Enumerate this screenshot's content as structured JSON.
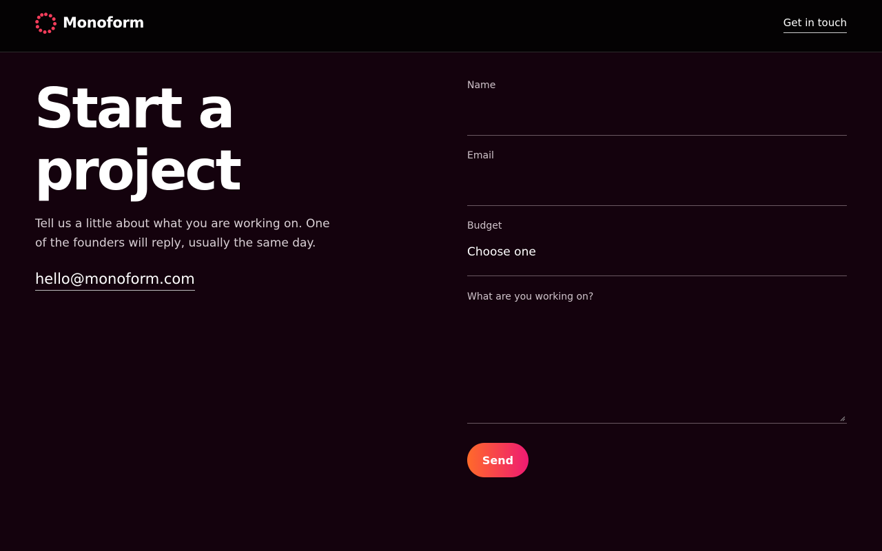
{
  "header": {
    "logo_icon": "ring-of-dots-logo-icon",
    "brand_name": "Monoform",
    "nav_link": "Get in touch"
  },
  "hero": {
    "title_line1": "Start a",
    "title_line2": "project",
    "subtitle": "Tell us a little about what you are working on. One of the founders will reply, usually the same day.",
    "email": "hello@monoform.com"
  },
  "form": {
    "name": {
      "label": "Name",
      "value": ""
    },
    "email": {
      "label": "Email",
      "value": ""
    },
    "budget": {
      "label": "Budget",
      "selected": "Choose one"
    },
    "message": {
      "label": "What are you working on?",
      "value": ""
    },
    "send_label": "Send"
  },
  "colors": {
    "background": "#14020d",
    "header_background": "#040203",
    "accent_start": "#ff6a2a",
    "accent_end": "#ee1a72"
  }
}
